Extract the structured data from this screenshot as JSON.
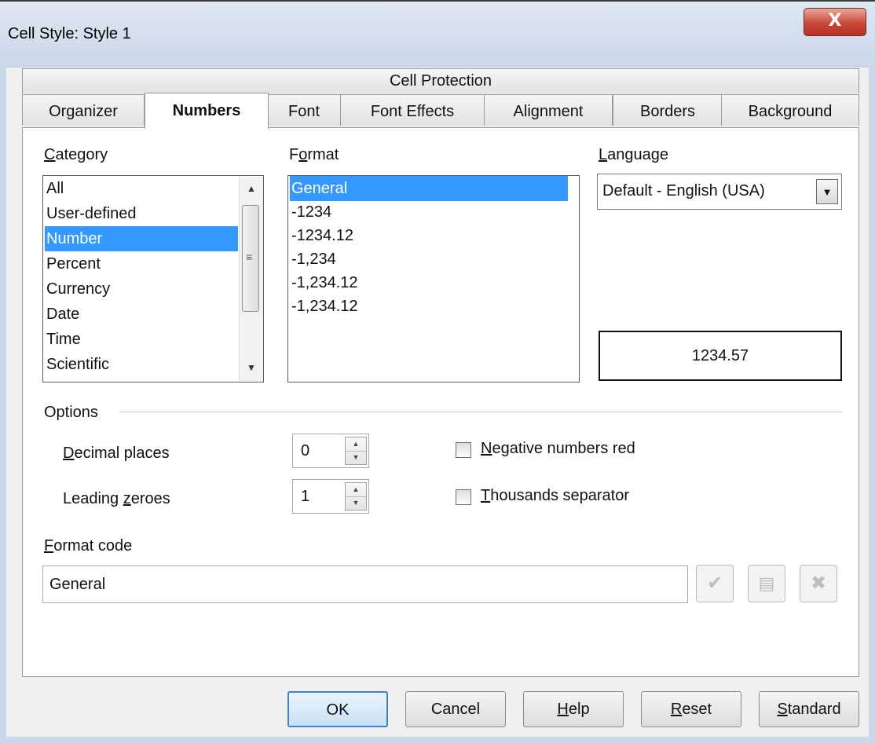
{
  "window": {
    "title": "Cell Style: Style 1",
    "close_glyph": "X"
  },
  "tabs": {
    "row1": [
      "Cell Protection"
    ],
    "row2": [
      "Organizer",
      "Numbers",
      "Font",
      "Font Effects",
      "Alignment",
      "Borders",
      "Background"
    ],
    "active": "Numbers"
  },
  "category": {
    "label": "Category",
    "items": [
      "All",
      "User-defined",
      "Number",
      "Percent",
      "Currency",
      "Date",
      "Time",
      "Scientific"
    ],
    "selected": "Number"
  },
  "format": {
    "label": "Format",
    "items": [
      "General",
      "-1234",
      "-1234.12",
      "-1,234",
      "-1,234.12",
      "-1,234.12"
    ],
    "selected": "General"
  },
  "language": {
    "label": "Language",
    "value": "Default - English (USA)"
  },
  "preview": {
    "value": "1234.57"
  },
  "options": {
    "label": "Options",
    "decimal_places": {
      "label": "Decimal places",
      "value": "0"
    },
    "leading_zeroes": {
      "label": "Leading zeroes",
      "value": "1"
    },
    "negative_red": {
      "label": "Negative numbers red",
      "checked": false
    },
    "thousands_sep": {
      "label": "Thousands separator",
      "checked": false
    }
  },
  "format_code": {
    "label": "Format code",
    "value": "General"
  },
  "buttons": {
    "ok": "OK",
    "cancel": "Cancel",
    "help": "Help",
    "reset": "Reset",
    "standard": "Standard"
  },
  "icons": {
    "accept": "checkmark-icon",
    "comment": "comment-icon",
    "delete": "delete-x-icon",
    "scroll_grip": "grip-icon"
  },
  "colors": {
    "selection": "#3399ff",
    "title_gradient_top": "#dfe8f3",
    "close_button": "#c9483a"
  }
}
